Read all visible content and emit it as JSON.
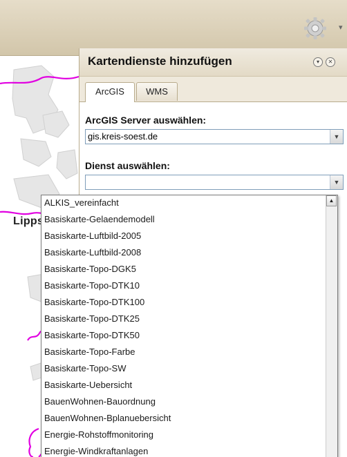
{
  "map": {
    "place_label": "Lippstadt"
  },
  "panel": {
    "title": "Kartendienste hinzufügen",
    "tabs": [
      {
        "label": "ArcGIS"
      },
      {
        "label": "WMS"
      }
    ],
    "server_label": "ArcGIS Server auswählen:",
    "server_value": "gis.kreis-soest.de",
    "service_label": "Dienst auswählen:",
    "service_value": ""
  },
  "services": [
    "ALKIS_vereinfacht",
    "Basiskarte-Gelaendemodell",
    "Basiskarte-Luftbild-2005",
    "Basiskarte-Luftbild-2008",
    "Basiskarte-Topo-DGK5",
    "Basiskarte-Topo-DTK10",
    "Basiskarte-Topo-DTK100",
    "Basiskarte-Topo-DTK25",
    "Basiskarte-Topo-DTK50",
    "Basiskarte-Topo-Farbe",
    "Basiskarte-Topo-SW",
    "Basiskarte-Uebersicht",
    "BauenWohnen-Bauordnung",
    "BauenWohnen-Bplanuebersicht",
    "Energie-Rohstoffmonitoring",
    "Energie-Windkraftanlagen"
  ],
  "icons": {
    "settings": "gear-icon",
    "collapse": "collapse-icon",
    "close": "close-icon",
    "dropdown": "chevron-down-icon"
  }
}
